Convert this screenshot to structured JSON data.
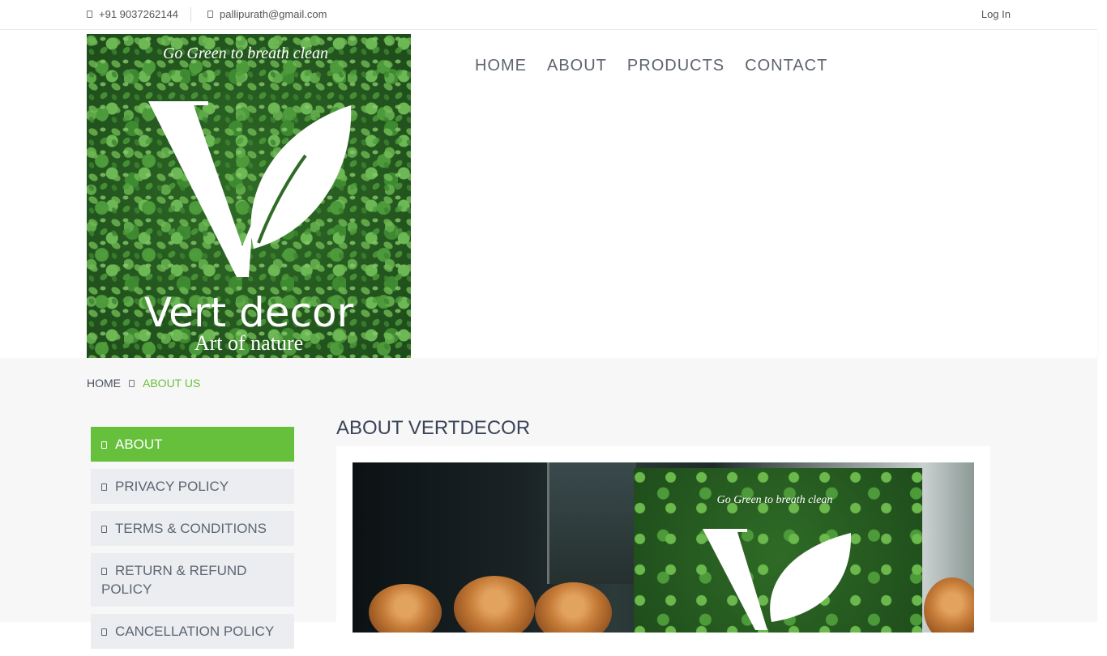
{
  "topbar": {
    "phone": "+91 9037262144",
    "email": "pallipurath@gmail.com",
    "login": "Log In",
    "phone_icon": "phone-icon",
    "email_icon": "envelope-icon"
  },
  "logo": {
    "tagline": "Go Green to breath clean",
    "brand": "Vert decor",
    "subtitle": "Art of nature"
  },
  "nav": {
    "items": [
      "HOME",
      "ABOUT",
      "PRODUCTS",
      "CONTACT"
    ]
  },
  "breadcrumb": {
    "home": "HOME",
    "current": "ABOUT US"
  },
  "sidebar": {
    "items": [
      {
        "label": "ABOUT",
        "active": true
      },
      {
        "label": "PRIVACY POLICY",
        "active": false
      },
      {
        "label": "TERMS & CONDITIONS",
        "active": false
      },
      {
        "label": "RETURN & REFUND POLICY",
        "active": false
      },
      {
        "label": "CANCELLATION POLICY",
        "active": false
      }
    ]
  },
  "main": {
    "title": "ABOUT VERTDECOR",
    "hero_tagline": "Go Green to breath clean"
  },
  "colors": {
    "accent": "#67c03c",
    "breadcrumb_active": "#6bbf3a",
    "nav_text": "#5e6470",
    "sidebar_bg": "#ebedf0"
  }
}
